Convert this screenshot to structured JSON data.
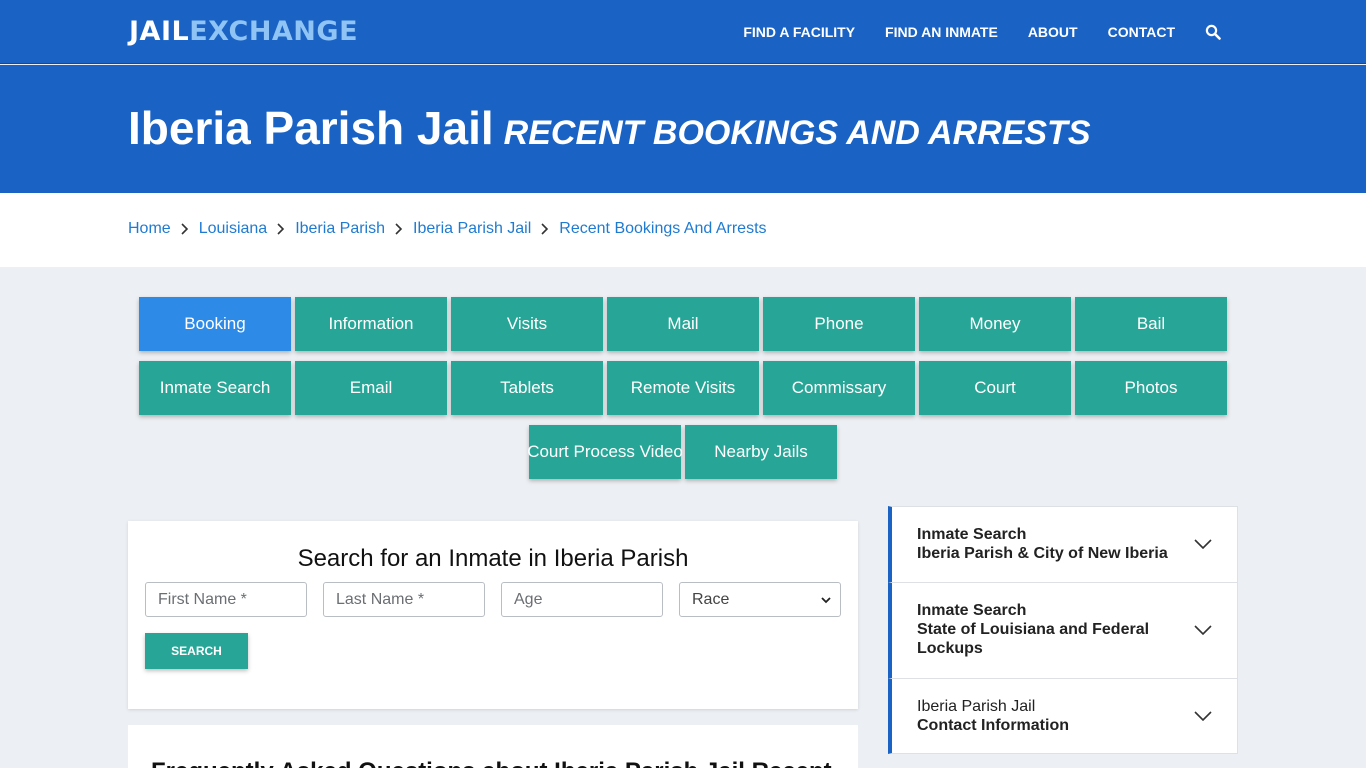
{
  "logo": {
    "part1": "JAIL",
    "part2": "EXCHANGE"
  },
  "nav": {
    "links": [
      "FIND A FACILITY",
      "FIND AN INMATE",
      "ABOUT",
      "CONTACT"
    ],
    "search_icon": "search-icon"
  },
  "hero": {
    "title": "Iberia Parish Jail",
    "subtitle": "RECENT BOOKINGS AND ARRESTS"
  },
  "breadcrumb": [
    "Home",
    "Louisiana",
    "Iberia Parish",
    "Iberia Parish Jail",
    "Recent Bookings And Arrests"
  ],
  "buttons": {
    "active": "Booking",
    "row1": [
      "Booking",
      "Information",
      "Visits",
      "Mail",
      "Phone",
      "Money",
      "Bail"
    ],
    "row2": [
      "Inmate Search",
      "Email",
      "Tablets",
      "Remote Visits",
      "Commissary",
      "Court",
      "Photos"
    ],
    "row3": [
      "Court Process Video",
      "Nearby Jails"
    ]
  },
  "search": {
    "title": "Search for an Inmate in Iberia Parish",
    "first_name_placeholder": "First Name *",
    "last_name_placeholder": "Last Name *",
    "age_placeholder": "Age",
    "race_selected": "Race",
    "button": "SEARCH"
  },
  "faq": {
    "title": "Frequently Asked Questions about Iberia Parish Jail Recent"
  },
  "sidebar": {
    "items": [
      {
        "line1": "Inmate Search",
        "line2": "Iberia Parish & City of New Iberia",
        "line3": ""
      },
      {
        "line1": "Inmate Search",
        "line2": "State of Louisiana and Federal",
        "line3": "Lockups"
      },
      {
        "line1": "Iberia Parish Jail",
        "line2": "Contact Information",
        "line3": ""
      }
    ]
  },
  "colors": {
    "brand_blue": "#1a63c5",
    "teal": "#27a697",
    "active_blue": "#2d8ae6",
    "link_blue": "#1f7bd1",
    "logo_accent": "#8fc4f5"
  }
}
